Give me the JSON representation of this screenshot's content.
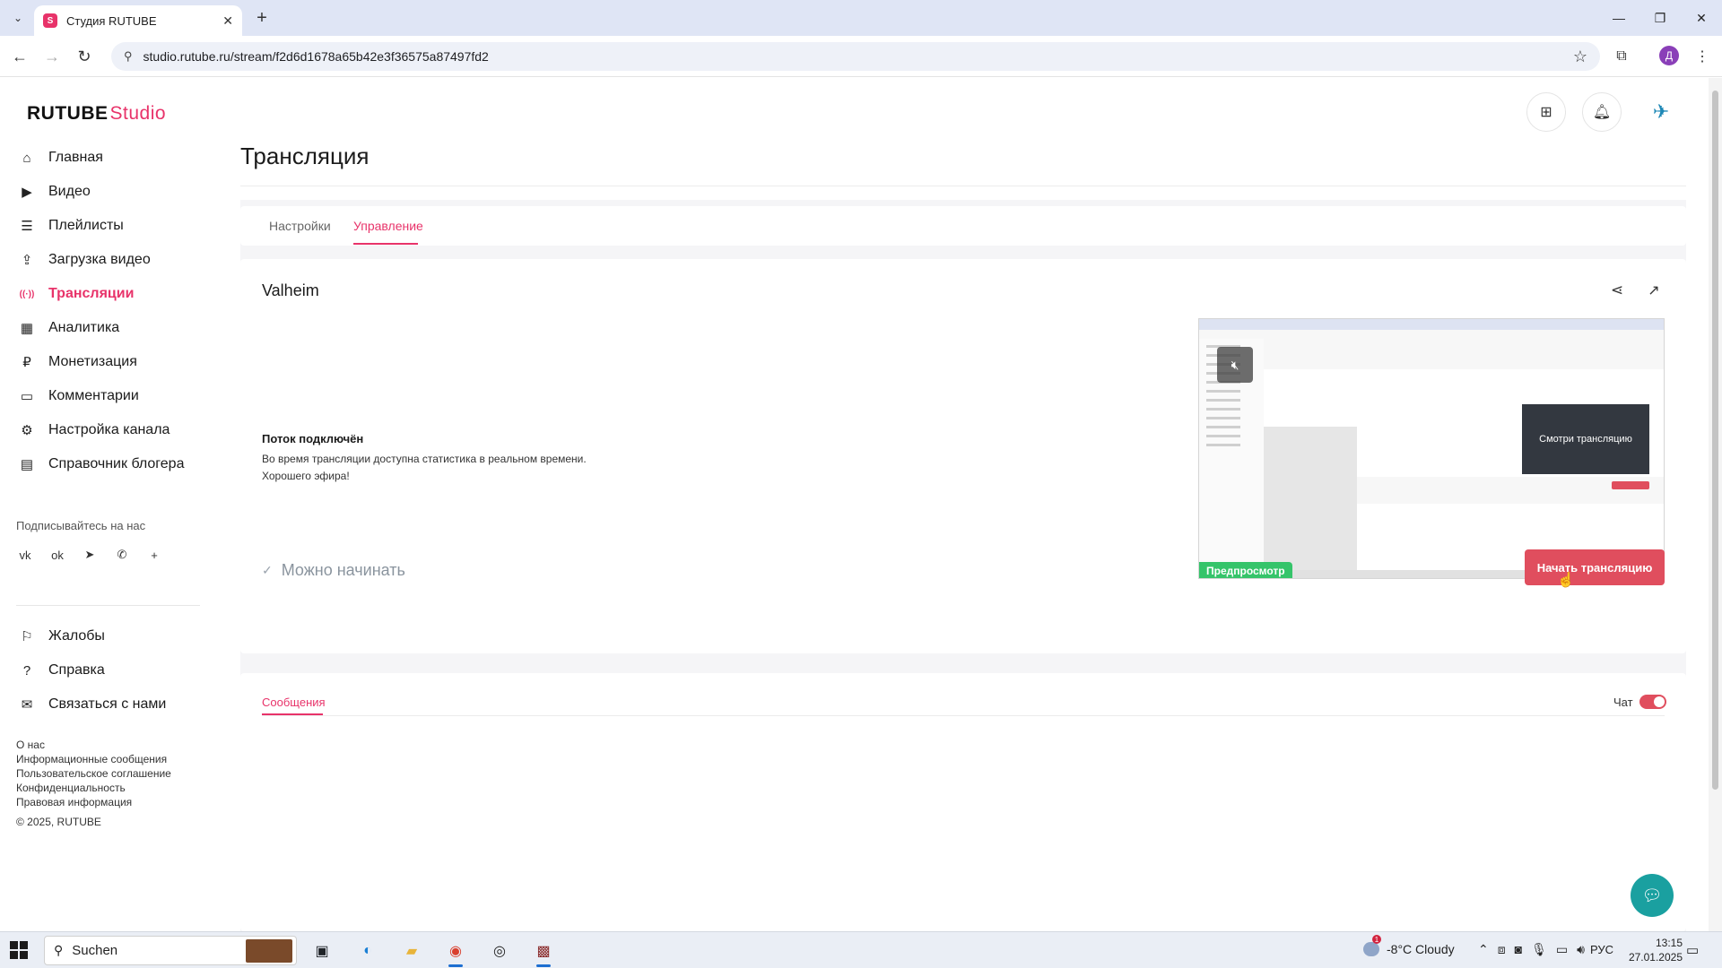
{
  "browser": {
    "tab_title": "Студия RUTUBE",
    "tab_favicon": "S",
    "url": "studio.rutube.ru/stream/f2d6d1678a65b42e3f36575a87497fd2",
    "profile_initial": "Д"
  },
  "app": {
    "logo_main": "RUTUBE",
    "logo_sub": "Studio",
    "brand_color": "#e8336a",
    "sidebar": [
      {
        "label": "Главная",
        "icon": "home-icon",
        "glyph": "⌂"
      },
      {
        "label": "Видео",
        "icon": "video-icon",
        "glyph": "▶"
      },
      {
        "label": "Плейлисты",
        "icon": "playlist-icon",
        "glyph": "☰"
      },
      {
        "label": "Загрузка видео",
        "icon": "upload-icon",
        "glyph": "⇪"
      },
      {
        "label": "Трансляции",
        "icon": "broadcast-icon",
        "glyph": "((·))",
        "active": true
      },
      {
        "label": "Аналитика",
        "icon": "analytics-icon",
        "glyph": "▦"
      },
      {
        "label": "Монетизация",
        "icon": "monetization-icon",
        "glyph": "₽"
      },
      {
        "label": "Комментарии",
        "icon": "comments-icon",
        "glyph": "▭"
      },
      {
        "label": "Настройка канала",
        "icon": "channel-settings-icon",
        "glyph": "⚙"
      },
      {
        "label": "Справочник блогера",
        "icon": "blogger-guide-icon",
        "glyph": "▤"
      }
    ],
    "follow_label": "Подписывайтесь на нас",
    "socials": [
      {
        "name": "vk-icon",
        "glyph": "vk"
      },
      {
        "name": "odnoklassniki-icon",
        "glyph": "ok"
      },
      {
        "name": "telegram-icon",
        "glyph": "➤"
      },
      {
        "name": "viber-icon",
        "glyph": "✆"
      },
      {
        "name": "more-icon",
        "glyph": "+"
      }
    ],
    "sidebar2": [
      {
        "label": "Жалобы",
        "icon": "complaints-icon",
        "glyph": "⚐"
      },
      {
        "label": "Справка",
        "icon": "help-icon",
        "glyph": "?"
      },
      {
        "label": "Связаться с нами",
        "icon": "mail-icon",
        "glyph": "✉"
      }
    ],
    "footer_links": [
      "О нас",
      "Информационные сообщения",
      "Пользовательское соглашение",
      "Конфиденциальность",
      "Правовая информация"
    ],
    "copyright": "© 2025, RUTUBE"
  },
  "page": {
    "title": "Трансляция",
    "tabs": [
      "Настройки",
      "Управление"
    ],
    "active_tab": "Управление",
    "stream": {
      "name": "Valheim",
      "status_title": "Поток подключён",
      "status_line1": "Во время трансляции доступна статистика в реальном времени.",
      "status_line2": "Хорошего эфира!",
      "preview_badge": "Предпросмотр",
      "preview_inner_text": "Смотри трансляцию",
      "ready_text": "Можно начинать",
      "start_button": "Начать трансляцию"
    },
    "messages": {
      "tab": "Сообщения",
      "chat_label": "Чат",
      "chat_enabled": true
    }
  },
  "taskbar": {
    "search_placeholder": "Suchen",
    "weather": "-8°C  Cloudy",
    "weather_badge": "1",
    "language": "РУС",
    "time": "13:15",
    "date": "27.01.2025"
  }
}
